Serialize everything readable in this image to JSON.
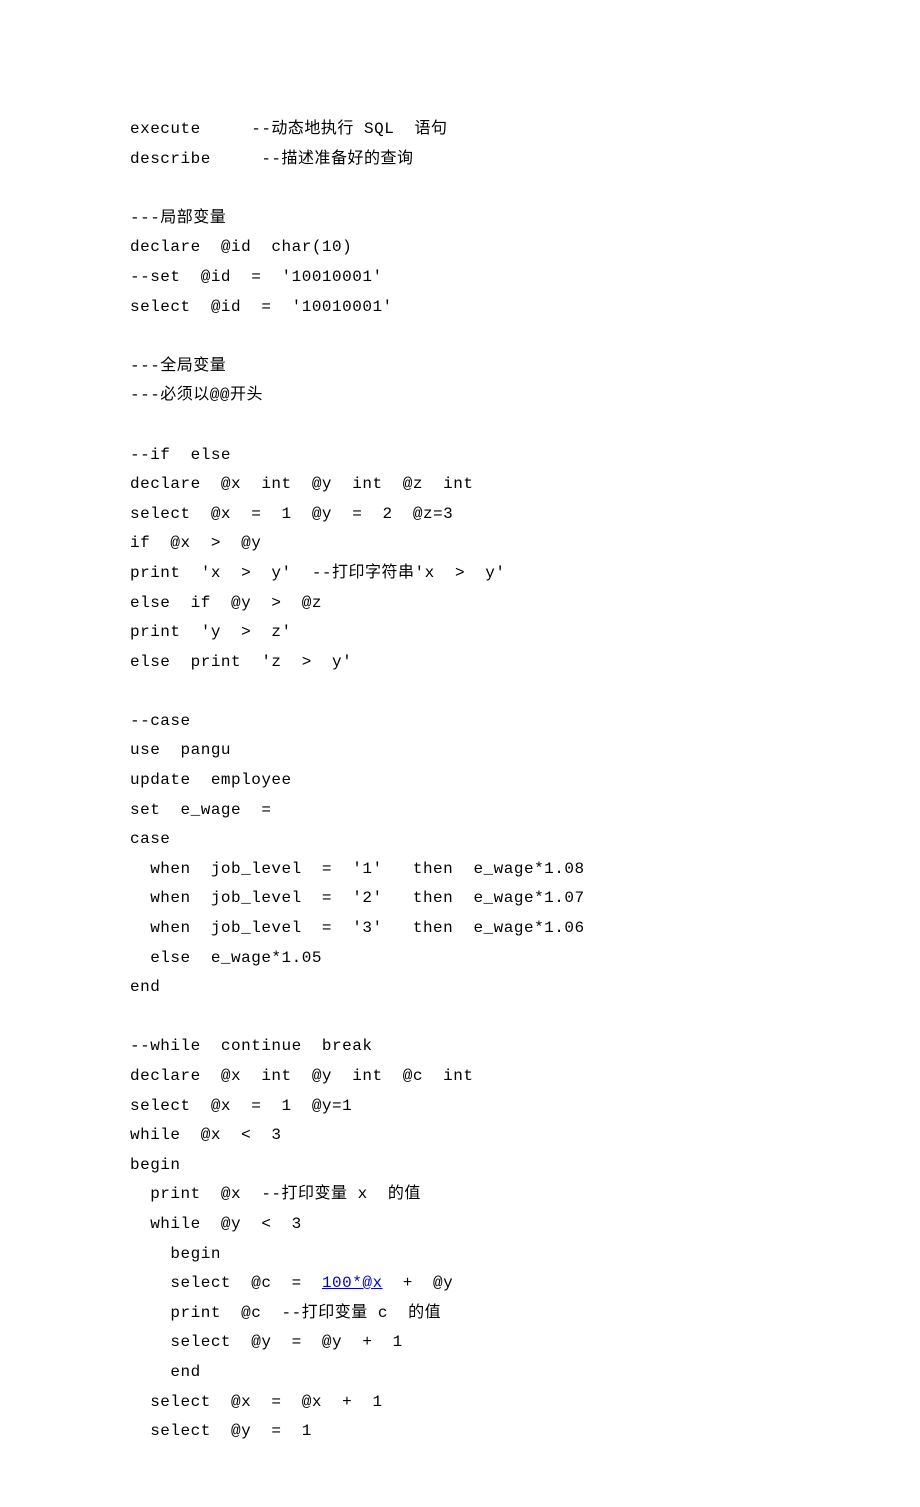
{
  "lines": [
    {
      "t": "execute     --动态地执行 SQL  语句"
    },
    {
      "t": "describe     --描述准备好的查询"
    },
    {
      "t": ""
    },
    {
      "t": "---局部变量"
    },
    {
      "t": "declare  @id  char(10)"
    },
    {
      "t": "--set  @id  =  '10010001'"
    },
    {
      "t": "select  @id  =  '10010001'"
    },
    {
      "t": ""
    },
    {
      "t": "---全局变量"
    },
    {
      "t": "---必须以@@开头"
    },
    {
      "t": ""
    },
    {
      "t": "--if  else"
    },
    {
      "t": "declare  @x  int  @y  int  @z  int"
    },
    {
      "t": "select  @x  =  1  @y  =  2  @z=3"
    },
    {
      "t": "if  @x  >  @y"
    },
    {
      "t": "print  'x  >  y'  --打印字符串'x  >  y'"
    },
    {
      "t": "else  if  @y  >  @z"
    },
    {
      "t": "print  'y  >  z'"
    },
    {
      "t": "else  print  'z  >  y'"
    },
    {
      "t": ""
    },
    {
      "t": "--case"
    },
    {
      "t": "use  pangu"
    },
    {
      "t": "update  employee"
    },
    {
      "t": "set  e_wage  ="
    },
    {
      "t": "case"
    },
    {
      "t": "  when  job_level  =  '1'   then  e_wage*1.08"
    },
    {
      "t": "  when  job_level  =  '2'   then  e_wage*1.07"
    },
    {
      "t": "  when  job_level  =  '3'   then  e_wage*1.06"
    },
    {
      "t": "  else  e_wage*1.05"
    },
    {
      "t": "end"
    },
    {
      "t": ""
    },
    {
      "t": "--while  continue  break"
    },
    {
      "t": "declare  @x  int  @y  int  @c  int"
    },
    {
      "t": "select  @x  =  1  @y=1"
    },
    {
      "t": "while  @x  <  3"
    },
    {
      "t": "begin"
    },
    {
      "t": "  print  @x  --打印变量 x  的值"
    },
    {
      "t": "  while  @y  <  3"
    },
    {
      "t": "    begin"
    },
    {
      "pre": "    select  @c  =  ",
      "link": "100*@x",
      "post": "  +  @y"
    },
    {
      "t": "    print  @c  --打印变量 c  的值"
    },
    {
      "t": "    select  @y  =  @y  +  1"
    },
    {
      "t": "    end"
    },
    {
      "t": "  select  @x  =  @x  +  1"
    },
    {
      "t": "  select  @y  =  1"
    }
  ]
}
